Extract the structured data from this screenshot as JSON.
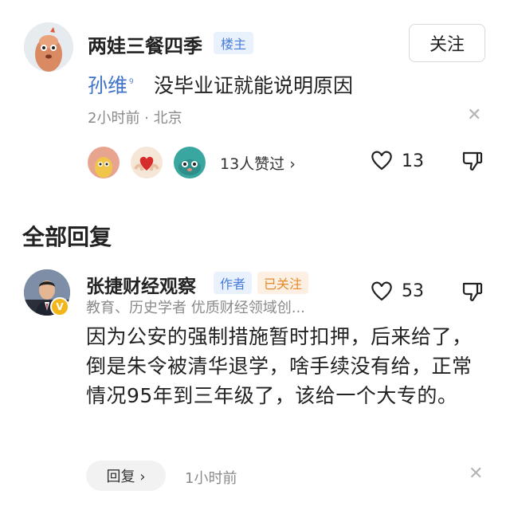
{
  "post": {
    "username": "两娃三餐四季",
    "owner_badge": "楼主",
    "follow_label": "关注",
    "mention": "孙维",
    "text": "没毕业证就能说明原因",
    "meta": "2小时前 · 北京",
    "likes_summary": "13人赞过 ›",
    "like_count": "13"
  },
  "replies_section": {
    "title": "全部回复"
  },
  "reply": {
    "name": "张捷财经观察",
    "author_tag": "作者",
    "followed_tag": "已关注",
    "bio": "教育、历史学者 优质财经领域创...",
    "like_count": "53",
    "text": "因为公安的强制措施暂时扣押，后来给了，倒是朱令被清华退学，啥手续没有给，正常情况95年到三年级了，该给一个大专的。",
    "reply_button": "回复 ›",
    "time": "1小时前"
  },
  "icons": {
    "heart": "heart-icon",
    "dislike": "thumbs-down-icon",
    "close": "close-icon",
    "verified": "verified-badge-icon"
  },
  "colors": {
    "link_blue": "#3f73c8",
    "badge_blue": "#4a7ddb",
    "followed_orange": "#e58a2c",
    "verified_gold": "#f2b61a"
  }
}
